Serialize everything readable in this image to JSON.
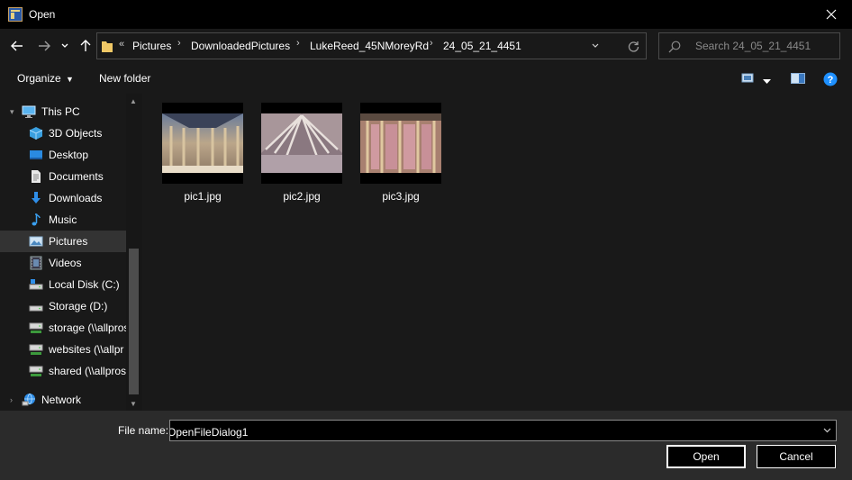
{
  "window": {
    "title": "Open"
  },
  "address": {
    "overflow": "«",
    "crumbs": [
      "Pictures",
      "DownloadedPictures",
      "LukeReed_45NMoreyRd",
      "24_05_21_4451"
    ]
  },
  "search": {
    "placeholder": "Search 24_05_21_4451"
  },
  "toolbar": {
    "organize": "Organize",
    "new_folder": "New folder"
  },
  "sidebar": {
    "items": [
      {
        "label": "This PC",
        "icon": "computer-icon"
      },
      {
        "label": "3D Objects",
        "icon": "cube-icon"
      },
      {
        "label": "Desktop",
        "icon": "desktop-icon"
      },
      {
        "label": "Documents",
        "icon": "document-icon"
      },
      {
        "label": "Downloads",
        "icon": "download-icon"
      },
      {
        "label": "Music",
        "icon": "music-icon"
      },
      {
        "label": "Pictures",
        "icon": "pictures-icon"
      },
      {
        "label": "Videos",
        "icon": "film-icon"
      },
      {
        "label": "Local Disk (C:)",
        "icon": "drive-icon"
      },
      {
        "label": "Storage (D:)",
        "icon": "drive-icon"
      },
      {
        "label": "storage (\\\\allpros",
        "icon": "network-drive-icon"
      },
      {
        "label": "websites (\\\\allpr",
        "icon": "network-drive-icon"
      },
      {
        "label": "shared (\\\\allpros",
        "icon": "network-drive-icon"
      },
      {
        "label": "Network",
        "icon": "network-icon"
      }
    ],
    "selected": "Pictures"
  },
  "files": [
    {
      "name": "pic1.jpg"
    },
    {
      "name": "pic2.jpg"
    },
    {
      "name": "pic3.jpg"
    }
  ],
  "bottom": {
    "file_name_label": "File name:",
    "file_name_value": "OpenFileDialog1",
    "open_label": "Open",
    "cancel_label": "Cancel"
  },
  "colors": {
    "accent": "#0078d7",
    "folder": "#f0c866",
    "help": "#1e90ff"
  }
}
